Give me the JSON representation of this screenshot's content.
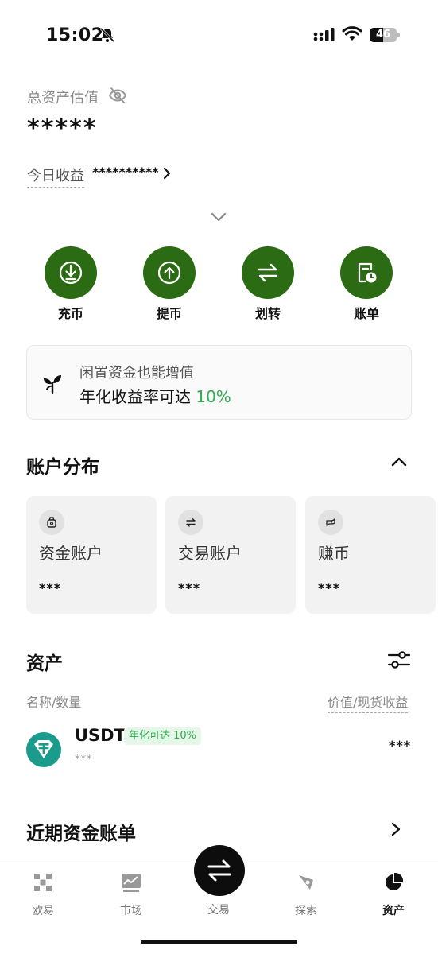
{
  "status_bar": {
    "time": "15:02",
    "battery": "46"
  },
  "overview": {
    "total_label": "总资产估值",
    "total_value": "*****",
    "today_label": "今日收益",
    "today_value": "**********"
  },
  "actions": [
    {
      "label": "充币",
      "icon": "deposit-icon"
    },
    {
      "label": "提币",
      "icon": "withdraw-icon"
    },
    {
      "label": "划转",
      "icon": "transfer-icon"
    },
    {
      "label": "账单",
      "icon": "bill-icon"
    }
  ],
  "promo": {
    "line1": "闲置资金也能增值",
    "line2": "年化收益率可达",
    "rate": "10%"
  },
  "accounts": {
    "title": "账户分布",
    "cards": [
      {
        "name": "资金账户",
        "value": "***",
        "icon": "funding-icon"
      },
      {
        "name": "交易账户",
        "value": "***",
        "icon": "trading-icon"
      },
      {
        "name": "赚币",
        "value": "***",
        "icon": "earn-icon"
      }
    ]
  },
  "assets": {
    "title": "资产",
    "col_name": "名称/数量",
    "col_value": "价值/现货收益",
    "rows": [
      {
        "symbol": "USDT",
        "badge": "年化可达 10%",
        "quantity": "***",
        "value": "***"
      }
    ]
  },
  "recent": {
    "title": "近期资金账单"
  },
  "tabbar": {
    "items": [
      {
        "label": "欧易",
        "icon": "okx-icon"
      },
      {
        "label": "市场",
        "icon": "market-icon"
      },
      {
        "label": "交易",
        "icon": "trade-icon"
      },
      {
        "label": "探索",
        "icon": "explore-icon"
      },
      {
        "label": "资产",
        "icon": "assets-icon"
      }
    ],
    "active": "资产"
  },
  "colors": {
    "accent_green": "#2b6b14",
    "highlight_green": "#2eae4f"
  }
}
